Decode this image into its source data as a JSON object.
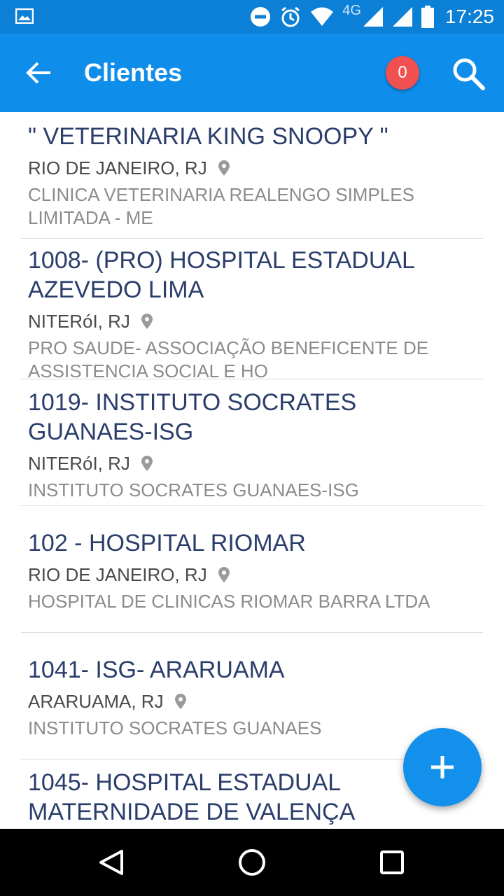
{
  "status_bar": {
    "network": "4G",
    "time": "17:25",
    "icons": [
      "image-icon",
      "do-not-disturb-icon",
      "alarm-icon",
      "wifi-icon",
      "signal-icon",
      "signal-icon",
      "battery-icon"
    ]
  },
  "app_bar": {
    "title": "Clientes",
    "badge_count": "0",
    "icons": [
      "back-arrow-icon",
      "search-icon"
    ]
  },
  "clients": [
    {
      "name": "\" VETERINARIA KING SNOOPY \"",
      "city": "RIO DE JANEIRO, RJ",
      "company": "CLINICA VETERINARIA REALENGO SIMPLES LIMITADA - ME"
    },
    {
      "name": "1008- (PRO) HOSPITAL ESTADUAL AZEVEDO LIMA",
      "city": "NITERóI, RJ",
      "company": "PRO SAUDE- ASSOCIAÇÃO BENEFICENTE DE ASSISTENCIA SOCIAL E HO"
    },
    {
      "name": "1019- INSTITUTO SOCRATES GUANAES-ISG",
      "city": "NITERóI, RJ",
      "company": "INSTITUTO SOCRATES GUANAES-ISG"
    },
    {
      "name": "102 - HOSPITAL RIOMAR",
      "city": "RIO DE JANEIRO, RJ",
      "company": "HOSPITAL DE CLINICAS RIOMAR BARRA LTDA"
    },
    {
      "name": "1041- ISG- ARARUAMA",
      "city": "ARARUAMA, RJ",
      "company": "INSTITUTO SOCRATES GUANAES"
    },
    {
      "name": "1045- HOSPITAL ESTADUAL MATERNIDADE DE VALENÇA",
      "city": "",
      "company": ""
    }
  ],
  "fab": {
    "icon": "plus-icon"
  },
  "nav_bar": {
    "icons": [
      "back-triangle-icon",
      "home-circle-icon",
      "recents-square-icon"
    ]
  },
  "colors": {
    "status_bar": "#0c7fd6",
    "app_bar": "#0f8deb",
    "badge": "#f05050",
    "fab": "#1390ec",
    "client_name": "#2b3e6b"
  }
}
